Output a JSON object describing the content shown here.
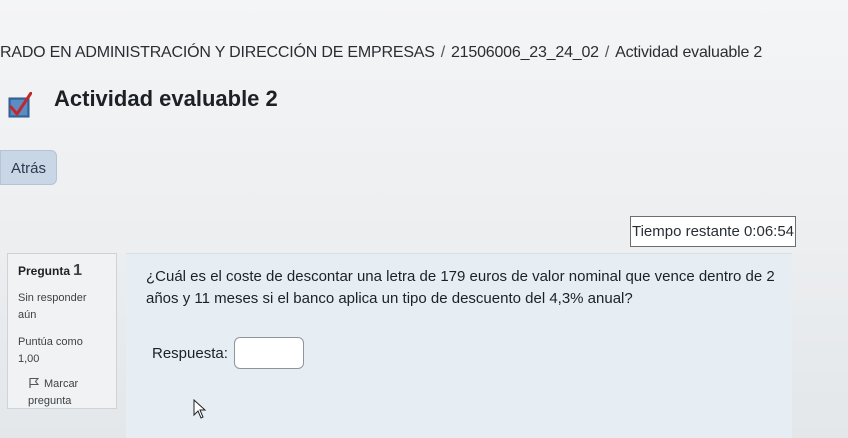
{
  "breadcrumb": {
    "items": [
      "RADO EN ADMINISTRACIÓN Y DIRECCIÓN DE EMPRESAS",
      "21506006_23_24_02",
      "Actividad evaluable 2"
    ],
    "separator": "/"
  },
  "page": {
    "title": "Actividad evaluable 2",
    "icon": "quiz-checkbox-icon"
  },
  "navigation": {
    "back_label": "Atrás"
  },
  "timer": {
    "text": "Tiempo restante 0:06:54"
  },
  "question_info": {
    "label": "Pregunta",
    "number": "1",
    "status": "Sin responder aún",
    "score": "Puntúa como 1,00",
    "flag_label": "Marcar pregunta"
  },
  "question": {
    "text": "¿Cuál es el coste de descontar una letra de 179 euros de valor nominal que vence dentro de 2 años y 11 meses si el banco aplica un tipo de descuento del 4,3% anual?",
    "answer_label": "Respuesta:",
    "answer_value": ""
  },
  "colors": {
    "back_button_bg": "#c8d6e6",
    "question_bg": "#e6eef4",
    "checkmark": "#c0292b"
  }
}
